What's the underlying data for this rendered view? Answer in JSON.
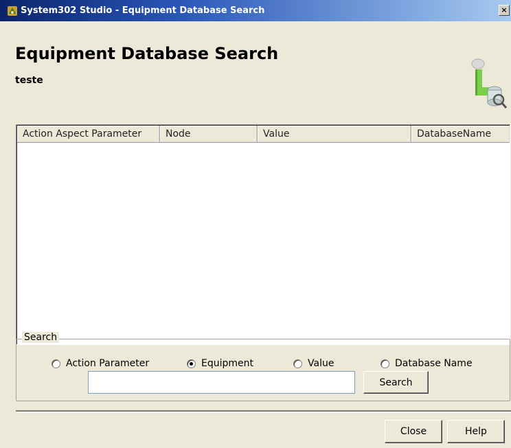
{
  "window": {
    "title": "System302 Studio - Equipment Database Search",
    "close_label": "×"
  },
  "header": {
    "title": "Equipment Database Search",
    "subtitle": "teste",
    "logo_icon": "database-search-icon"
  },
  "list": {
    "columns": [
      "Action Aspect Parameter",
      "Node",
      "Value",
      "DatabaseName"
    ],
    "rows": []
  },
  "search": {
    "group_label": "Search",
    "options": [
      {
        "label": "Action Parameter",
        "checked": false
      },
      {
        "label": "Equipment",
        "checked": true
      },
      {
        "label": "Value",
        "checked": false
      },
      {
        "label": "Database Name",
        "checked": false
      }
    ],
    "input_value": "",
    "button_label": "Search"
  },
  "footer": {
    "close_label": "Close",
    "help_label": "Help"
  },
  "colors": {
    "titlebar_start": "#0a246a",
    "titlebar_end": "#a6caf0",
    "dialog_bg": "#ece9d8"
  }
}
